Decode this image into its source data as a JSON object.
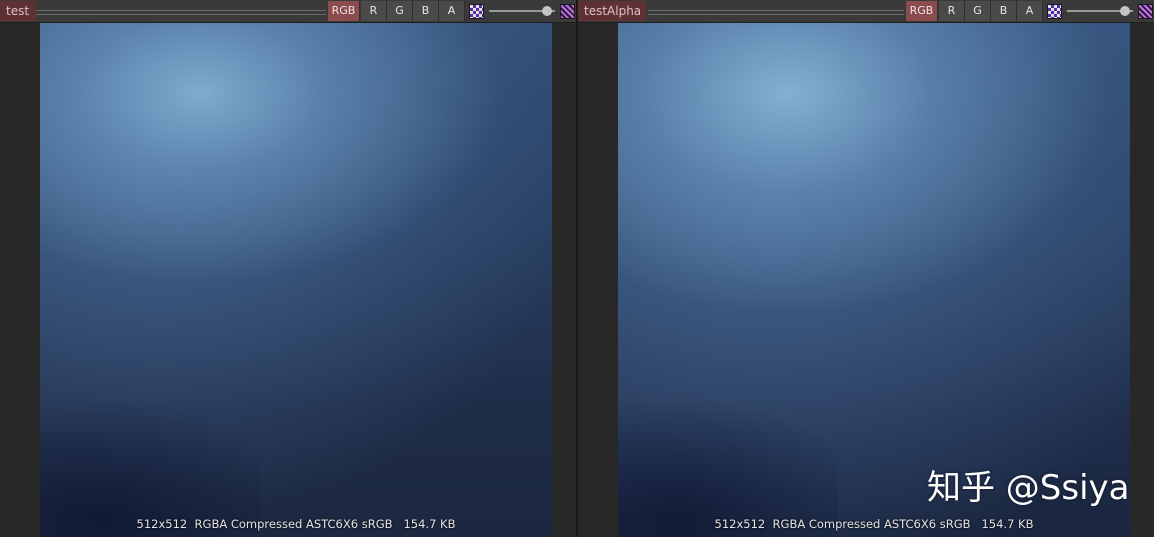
{
  "panels": [
    {
      "texture_name": "test",
      "channels": [
        "RGB",
        "R",
        "G",
        "B",
        "A"
      ],
      "active_channel": "RGB",
      "texture_info": "512x512  RGBA Compressed ASTC6X6 sRGB   154.7 KB"
    },
    {
      "texture_name": "testAlpha",
      "channels": [
        "RGB",
        "R",
        "G",
        "B",
        "A"
      ],
      "active_channel": "RGB",
      "texture_info": "512x512  RGBA Compressed ASTC6X6 sRGB   154.7 KB"
    }
  ],
  "watermark": "知乎 @Ssiya",
  "colors": {
    "active_channel": "#8b4c4e",
    "name_tab": "#5e3234",
    "toolbar": "#3a3a3a",
    "background": "#282828"
  },
  "icons": {
    "checker": "checker-icon",
    "alpha_blend": "alpha-blend-icon"
  }
}
